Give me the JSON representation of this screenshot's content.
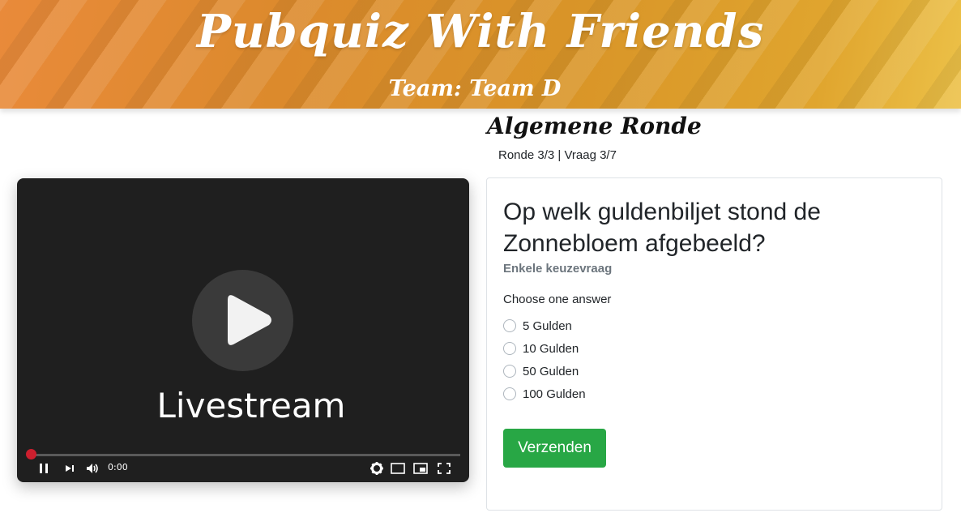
{
  "header": {
    "site_title": "Pubquiz With Friends",
    "team_label": "Team: Team D"
  },
  "round": {
    "title": "Algemene Ronde",
    "progress": "Ronde 3/3 | Vraag 3/7"
  },
  "video": {
    "label": "Livestream",
    "time": "0:00",
    "played_fraction": 0,
    "icons": [
      "play-icon",
      "pause-icon",
      "next-icon",
      "volume-icon",
      "settings-icon",
      "theater-mode-icon",
      "miniplayer-icon",
      "fullscreen-icon"
    ]
  },
  "question": {
    "text": "Op welk guldenbiljet stond de Zonnebloem afgebeeld?",
    "type": "Enkele keuzevraag",
    "instruction": "Choose one answer",
    "answers": [
      "5 Gulden",
      "10 Gulden",
      "50 Gulden",
      "100 Gulden"
    ],
    "submit_label": "Verzenden"
  },
  "colors": {
    "header_accent": "#e09a2e",
    "submit_button": "#28a745",
    "progress_knob": "#cc1f2e",
    "player_background": "#1f1f1f"
  }
}
